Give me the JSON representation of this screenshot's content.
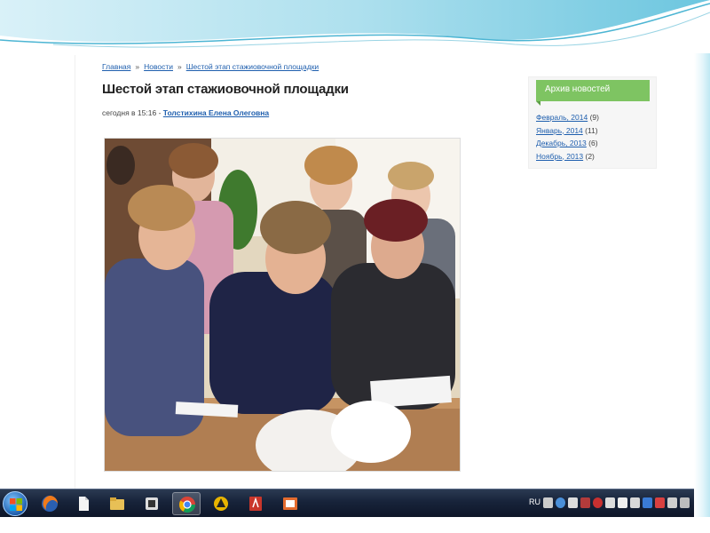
{
  "breadcrumb": {
    "items": [
      "Главная",
      "Новости",
      "Шестой этап стажиовочной площадки"
    ],
    "separator": "»"
  },
  "article": {
    "title": "Шестой этап стажиовочной площадки",
    "date": "сегодня в 15:16",
    "date_separator": "-",
    "author": "Толстихина Елена Олеговна"
  },
  "archive": {
    "title": "Архив новостей",
    "items": [
      {
        "label": "Февраль, 2014",
        "count": "(9)"
      },
      {
        "label": "Январь, 2014",
        "count": "(11)"
      },
      {
        "label": "Декабрь, 2013",
        "count": "(6)"
      },
      {
        "label": "Ноябрь, 2013",
        "count": "(2)"
      }
    ]
  },
  "taskbar": {
    "language": "RU",
    "apps": [
      "firefox-icon",
      "file-icon",
      "folder-icon",
      "media-player-icon",
      "chrome-icon",
      "app-icon",
      "word-icon",
      "presentation-icon"
    ]
  },
  "colors": {
    "widget_header": "#7ec462",
    "link": "#1f5fae",
    "taskbar": "#17233a"
  }
}
